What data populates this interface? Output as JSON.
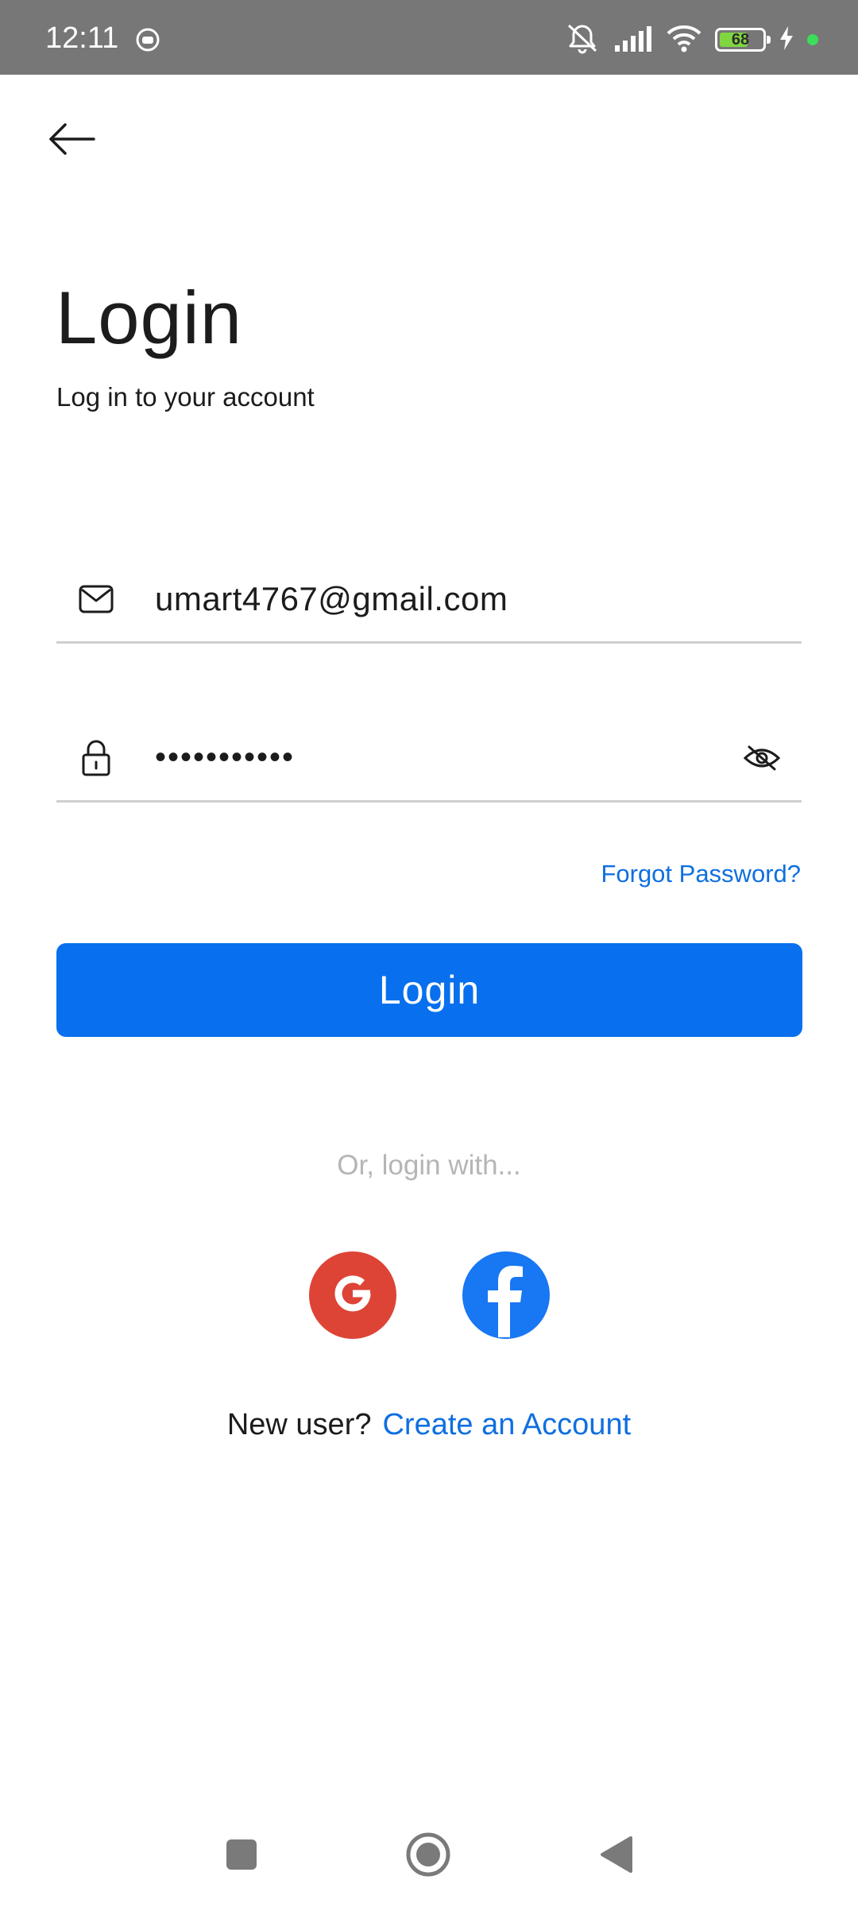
{
  "status_bar": {
    "time": "12:11",
    "battery_level": "68",
    "battery_fill_percent": 68,
    "icons": [
      "app-notification-icon",
      "mute-icon",
      "signal-icon",
      "wifi-icon",
      "battery-icon",
      "charging-icon",
      "active-dot"
    ]
  },
  "header": {
    "back_icon": "arrow-left-icon"
  },
  "title": "Login",
  "subtitle": "Log in to your account",
  "form": {
    "email": {
      "icon": "mail-icon",
      "value": "umart4767@gmail.com"
    },
    "password": {
      "icon": "lock-icon",
      "value": "•••••••••••",
      "toggle_icon": "eye-off-icon"
    },
    "forgot_password": "Forgot Password?",
    "login_button": "Login"
  },
  "social": {
    "divider_text": "Or, login with...",
    "providers": [
      {
        "name": "google",
        "icon": "google-icon",
        "color": "#dd4436"
      },
      {
        "name": "facebook",
        "icon": "facebook-icon",
        "color": "#1877f2"
      }
    ]
  },
  "signup": {
    "prompt": "New user?",
    "link": "Create an Account"
  },
  "colors": {
    "accent": "#0870ee",
    "link": "#0f6fe0",
    "status_bar": "#777777"
  },
  "nav_bar": {
    "icons": [
      "recents-icon",
      "home-icon",
      "back-triangle-icon"
    ]
  }
}
